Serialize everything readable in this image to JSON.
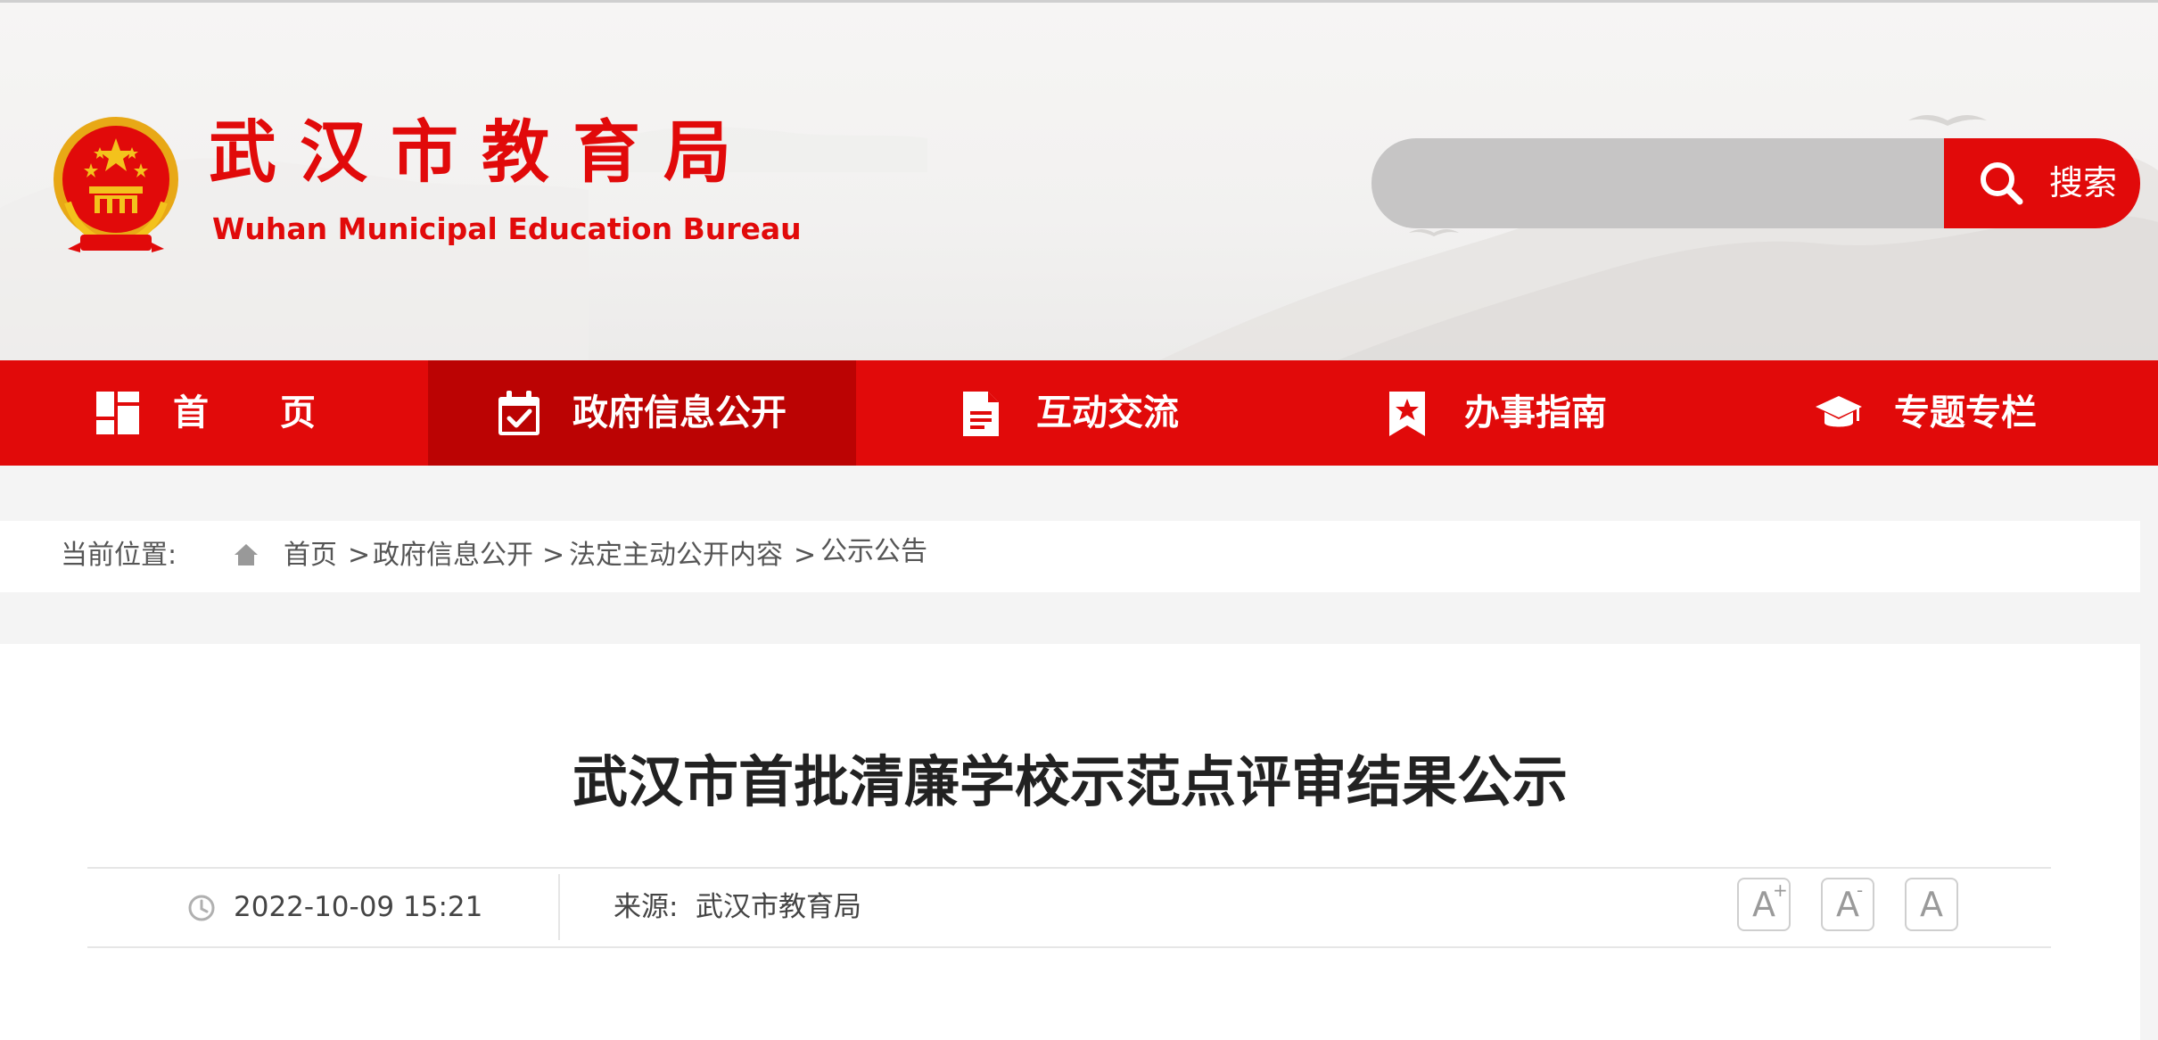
{
  "header": {
    "title": "武汉市教育局",
    "subtitle": "Wuhan Municipal Education Bureau",
    "search_placeholder": "",
    "search_button_label": "搜索"
  },
  "nav": {
    "items": [
      {
        "label": "首　　页",
        "icon": "home-grid-icon",
        "active": false
      },
      {
        "label": "政府信息公开",
        "icon": "calendar-check-icon",
        "active": true
      },
      {
        "label": "互动交流",
        "icon": "document-icon",
        "active": false
      },
      {
        "label": "办事指南",
        "icon": "bookmark-star-icon",
        "active": false
      },
      {
        "label": "专题专栏",
        "icon": "graduation-cap-icon",
        "active": false
      }
    ]
  },
  "breadcrumb": {
    "label": "当前位置:",
    "items": [
      "首页",
      "政府信息公开",
      "法定主动公开内容",
      "公示公告"
    ],
    "separator": ">"
  },
  "article": {
    "title": "武汉市首批清廉学校示范点评审结果公示",
    "date": "2022-10-09 15:21",
    "source_label": "来源:",
    "source": "武汉市教育局",
    "font_size_buttons": [
      {
        "label": "A",
        "mark": "+"
      },
      {
        "label": "A",
        "mark": "-"
      },
      {
        "label": "A",
        "mark": ""
      }
    ]
  },
  "colors": {
    "brand_red": "#e10a0a",
    "nav_active": "#bb0303",
    "search_field": "#c6c5c5",
    "page_background": "#f4f4f4"
  }
}
